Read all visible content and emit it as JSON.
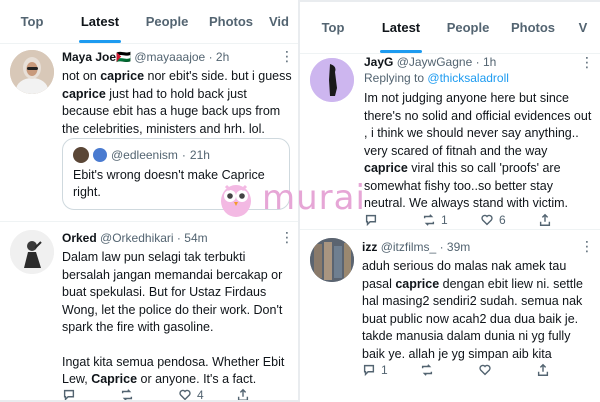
{
  "left": {
    "tabs": [
      "Top",
      "Latest",
      "People",
      "Photos",
      "Vid"
    ],
    "active_tab": "Latest",
    "tweets": [
      {
        "name": "Maya Joe",
        "name_emoji": "🇵🇸",
        "handle": "@mayaaajoe",
        "time": "2h",
        "text_parts": [
          "not on ",
          "caprice",
          " nor ebit's side. but i guess ",
          "caprice",
          " just had to hold back just because ebit has a huge back ups from the celebrities, ministers and hrh. lol."
        ],
        "quote": {
          "handle": "@edleenism",
          "time": "21h",
          "text": "Ebit's wrong doesn't make Caprice right."
        }
      },
      {
        "name": "Orked",
        "handle": "@Orkedhikari",
        "time": "54m",
        "text_parts": [
          "Dalam law pun selagi tak terbukti bersalah jangan memandai bercakap or buat spekulasi. But for Ustaz Firdaus Wong, let the police do their work. Don't spark the fire with gasoline.",
          "Ingat kita semua pendosa. Whether Ebit Lew, ",
          "Caprice",
          " or anyone. It's a fact."
        ],
        "likes": "4"
      }
    ]
  },
  "right": {
    "tabs": [
      "Top",
      "Latest",
      "People",
      "Photos",
      "V"
    ],
    "active_tab": "Latest",
    "tweets": [
      {
        "name": "JayG",
        "handle": "@JaywGagne",
        "time": "1h",
        "replying_label": "Replying to",
        "replying_to": "@thicksaladroll",
        "text_parts": [
          "Im not judging anyone here but since there's no solid and official evidences out , i think we should never say anything.. very scared of fitnah and the way ",
          "caprice",
          " viral this so call 'proofs' are somewhat fishy too..so better stay neutral. We always stand with victim."
        ],
        "retweets": "1",
        "likes": "6"
      },
      {
        "name": "izz",
        "handle": "@itzfilms_",
        "time": "39m",
        "text_parts": [
          "aduh serious do malas nak amek tau pasal ",
          "caprice",
          " dengan ebit liew ni. settle hal masing2 sendiri2 sudah. semua nak buat public now acah2 dua dua baik je. takde manusia dalam dunia ni yg fully baik ye. allah je yg simpan aib kita"
        ],
        "replies": "1"
      }
    ]
  },
  "watermark": "murai",
  "colors": {
    "accent": "#1d9bf0",
    "watermark": "#e6a6d6"
  },
  "icons": [
    "reply-icon",
    "retweet-icon",
    "like-icon",
    "share-icon",
    "more-icon"
  ]
}
